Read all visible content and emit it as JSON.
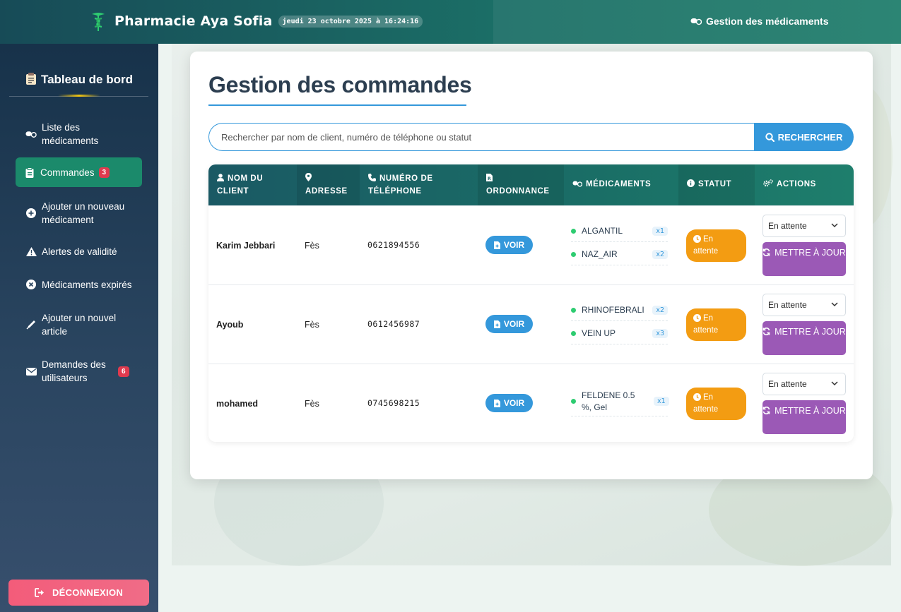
{
  "header": {
    "app_title": "Pharmacie Aya Sofia",
    "datetime": "jeudi 23 octobre 2025 à 16:24:16",
    "nav_link": "Gestion des médicaments",
    "nav_link_icon": "pills-icon",
    "logo_icon": "caduceus-icon"
  },
  "sidebar": {
    "title": "Tableau de bord",
    "title_icon": "clipboard-icon",
    "items": [
      {
        "label": "Liste des médicaments",
        "icon": "pills-icon",
        "active": false
      },
      {
        "label": "Commandes",
        "icon": "clipboard-list-icon",
        "active": true,
        "badge": "3"
      },
      {
        "label": "Ajouter un nouveau médicament",
        "icon": "plus-circle-icon",
        "active": false
      },
      {
        "label": "Alertes de validité",
        "icon": "warning-icon",
        "active": false
      },
      {
        "label": "Médicaments expirés",
        "icon": "times-circle-icon",
        "active": false
      },
      {
        "label": "Ajouter un nouvel article",
        "icon": "pen-icon",
        "active": false
      },
      {
        "label": "Demandes des utilisateurs",
        "icon": "envelope-icon",
        "active": false,
        "badge": "6"
      }
    ],
    "logout_label": "DÉCONNEXION"
  },
  "main": {
    "title": "Gestion des commandes",
    "search": {
      "placeholder": "Rechercher par nom de client, numéro de téléphone ou statut",
      "button_label": "RECHERCHER"
    },
    "table": {
      "columns": [
        {
          "label": "NOM DU CLIENT",
          "icon": "user-icon"
        },
        {
          "label": "ADRESSE",
          "icon": "map-marker-icon"
        },
        {
          "label": "NUMÉRO DE TÉLÉPHONE",
          "icon": "phone-icon"
        },
        {
          "label": "ORDONNANCE",
          "icon": "file-prescription-icon"
        },
        {
          "label": "MÉDICAMENTS",
          "icon": "pills-icon"
        },
        {
          "label": "STATUT",
          "icon": "info-circle-icon"
        },
        {
          "label": "ACTIONS",
          "icon": "cogs-icon"
        }
      ],
      "rows": [
        {
          "client": "Karim Jebbari",
          "address": "Fès",
          "phone": "0621894556",
          "prescription_button": "VOIR",
          "medications": [
            {
              "name": "ALGANTIL",
              "qty": "x1"
            },
            {
              "name": "NAZ_AIR",
              "qty": "x2"
            }
          ],
          "status": "En attente",
          "select_value": "En attente",
          "update_button": "METTRE À JOUR"
        },
        {
          "client": "Ayoub",
          "address": "Fès",
          "phone": "0612456987",
          "prescription_button": "VOIR",
          "medications": [
            {
              "name": "RHINOFEBRALI",
              "qty": "x2"
            },
            {
              "name": "VEIN UP",
              "qty": "x3"
            }
          ],
          "status": "En attente",
          "select_value": "En attente",
          "update_button": "METTRE À JOUR"
        },
        {
          "client": "mohamed",
          "address": "Fès",
          "phone": "0745698215",
          "prescription_button": "VOIR",
          "medications": [
            {
              "name": "FELDENE 0.5 %, Gel",
              "qty": "x1"
            }
          ],
          "status": "En attente",
          "select_value": "En attente",
          "update_button": "METTRE À JOUR"
        }
      ]
    }
  },
  "colors": {
    "header": "#1b6e66",
    "sidebar": "#2a4560",
    "active_nav": "#1b8a6b",
    "primary_blue": "#3498db",
    "status_pending": "#f39c12",
    "update_button": "#9b59b6",
    "logout": "#f35c7a",
    "badge": "#e03a4e"
  }
}
